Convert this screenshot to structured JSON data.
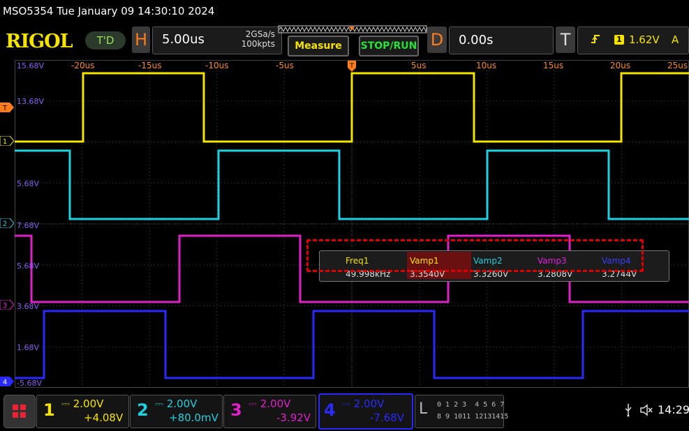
{
  "header": {
    "model_datetime": "MSO5354  Tue January 09 14:30:10 2024",
    "logo": "RIGOL",
    "trigger_status": "T'D"
  },
  "horizontal": {
    "letter": "H",
    "scale": "5.00us",
    "sample_rate": "2GSa/s",
    "mem_depth": "100kpts"
  },
  "buttons": {
    "measure": "Measure",
    "stop_run": "STOP/RUN"
  },
  "delay": {
    "letter": "D",
    "value": "0.00s"
  },
  "trigger": {
    "letter": "T",
    "edge_icon": "rising-edge-icon",
    "source": "1",
    "level": "1.62V",
    "mode": "A"
  },
  "grid": {
    "x_labels": [
      "-20us",
      "-15us",
      "-10us",
      "-5us",
      "5us",
      "10us",
      "15us",
      "20us",
      "25us"
    ],
    "y_labels": [
      "15.68V",
      "13.68V",
      "5.68V",
      "7.68V",
      "5.68V",
      "3.68V",
      "1.68V",
      "-5.68V"
    ]
  },
  "markers": {
    "trigger_level": "T",
    "ch1": "1",
    "ch2": "2",
    "ch3": "3",
    "ch4": "4"
  },
  "measurements": {
    "headers": [
      "Freq1",
      "Vamp1",
      "Vamp2",
      "Vamp3",
      "Vamp4"
    ],
    "values": [
      "49.998kHz",
      "3.3540V",
      "3.3260V",
      "3.2808V",
      "3.2744V"
    ],
    "header_colors": [
      "#f5e400",
      "#f5e400",
      "#20d0e0",
      "#e020e0",
      "#3b3bff"
    ]
  },
  "channels": [
    {
      "num": "1",
      "scale": "2.00V",
      "offset": "+4.08V",
      "color": "#f5e400"
    },
    {
      "num": "2",
      "scale": "2.00V",
      "offset": "+80.0mV",
      "color": "#20d0e0"
    },
    {
      "num": "3",
      "scale": "2.00V",
      "offset": "-3.92V",
      "color": "#e020c8"
    },
    {
      "num": "4",
      "scale": "2.00V",
      "offset": "-7.68V",
      "color": "#2a2aff"
    }
  ],
  "logic": {
    "letter": "L",
    "row1": "0 1 2 3  4 5 6 7",
    "row2": "8 9 1011 12131415"
  },
  "status": {
    "usb_icon": "usb-icon",
    "speaker_icon": "speaker-muted-icon",
    "time": "14:29"
  },
  "colors": {
    "ch1": "#f5e400",
    "ch2": "#20d0e0",
    "ch3": "#e020c8",
    "ch4": "#2a2aff",
    "accent": "#ff7a1a",
    "grid": "#555555"
  }
}
